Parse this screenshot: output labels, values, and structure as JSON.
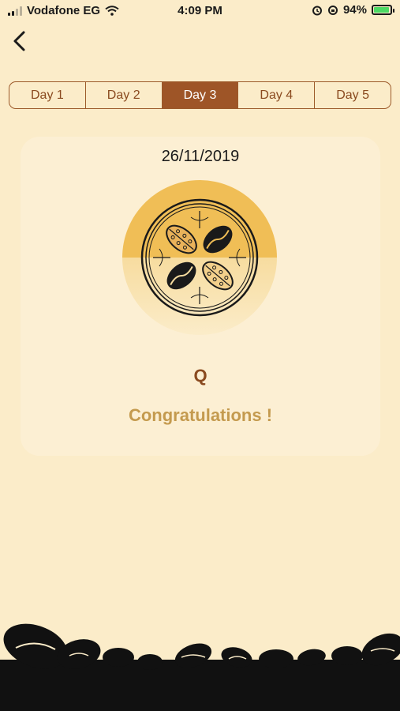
{
  "status_bar": {
    "carrier": "Vodafone EG",
    "time": "4:09 PM",
    "battery": "94%",
    "battery_level": 0.94
  },
  "header": {
    "back_icon": "chevron-left-icon"
  },
  "tabs": [
    {
      "label": "Day 1",
      "active": false
    },
    {
      "label": "Day 2",
      "active": false
    },
    {
      "label": "Day 3",
      "active": true
    },
    {
      "label": "Day 4",
      "active": false
    },
    {
      "label": "Day 5",
      "active": false
    }
  ],
  "card": {
    "date": "26/11/2019",
    "badge_icon": "coffee-beans-medallion-icon",
    "letter": "Q",
    "message": "Congratulations !"
  },
  "colors": {
    "background": "#fbecc9",
    "accent": "#9e5527",
    "card": "#fcefd3",
    "badge_top": "#f0be56",
    "congrats": "#c49a4e"
  }
}
